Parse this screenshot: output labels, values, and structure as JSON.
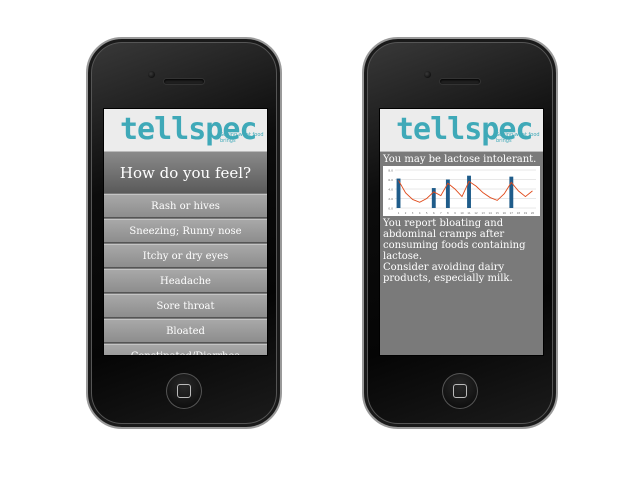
{
  "brand": {
    "logo_text": "tellspec",
    "tagline": "Seeing what food brings",
    "accent_color": "#3fa9b8"
  },
  "left_screen": {
    "question": "How do you feel?",
    "options": [
      "Rash or hives",
      "Sneezing; Runny nose",
      "Itchy or dry eyes",
      "Headache",
      "Sore throat",
      "Bloated",
      "Constipated/Diarrhea"
    ]
  },
  "right_screen": {
    "headline": "You may be lactose intolerant.",
    "report": "You report bloating and abdominal cramps after consuming foods containing lactose.",
    "advice": "Consider avoiding dairy products, especially milk."
  },
  "chart_data": {
    "type": "bar",
    "bar_color": "#1f5c8a",
    "line_color": "#e04a1a",
    "categories": [
      "1",
      "2",
      "3",
      "4",
      "5",
      "6",
      "7",
      "8",
      "9",
      "10",
      "11",
      "12",
      "13",
      "14",
      "15",
      "16",
      "17",
      "18",
      "19",
      "20"
    ],
    "bar_values": [
      6.2,
      0,
      0,
      0,
      0,
      4.2,
      0,
      6.0,
      0,
      0,
      6.8,
      0,
      0,
      0,
      0,
      0,
      6.6,
      0,
      0,
      0
    ],
    "line_values": [
      5.8,
      3.2,
      1.8,
      1.2,
      2.0,
      3.4,
      2.6,
      5.2,
      4.0,
      2.4,
      5.6,
      4.6,
      3.2,
      2.2,
      1.6,
      3.0,
      5.4,
      3.6,
      2.4,
      3.6
    ],
    "ylim": [
      0,
      8
    ],
    "grid": true
  }
}
